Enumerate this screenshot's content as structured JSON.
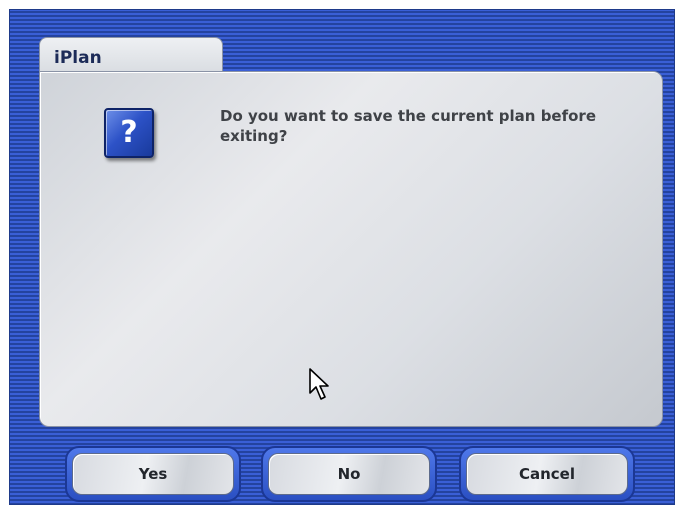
{
  "dialog": {
    "title": "iPlan",
    "icon": "question-icon",
    "icon_glyph": "?",
    "message": "Do you want to save the current plan before exiting?"
  },
  "buttons": {
    "yes_label": "Yes",
    "no_label": "No",
    "cancel_label": "Cancel"
  },
  "colors": {
    "frame_blue": "#3a5fd6",
    "panel_gray": "#dcdfe4",
    "icon_blue": "#2d52c7"
  }
}
